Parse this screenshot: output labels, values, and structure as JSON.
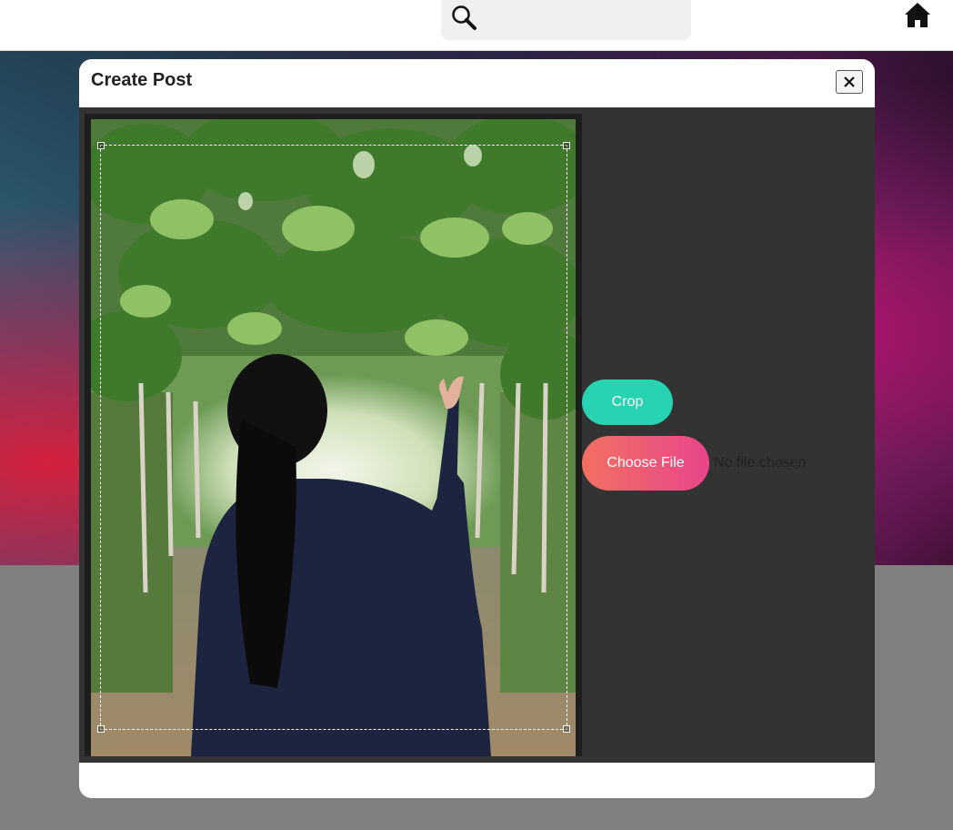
{
  "search": {
    "placeholder": "",
    "value": ""
  },
  "nav": {
    "home_icon": "home-icon"
  },
  "modal": {
    "title": "Create Post",
    "close_label": "✕",
    "crop_label": "Crop",
    "choose_file_label": "Choose File",
    "file_status": "No file chosen"
  },
  "colors": {
    "crop_button": "#27d3b0",
    "choose_file_start": "#f27062",
    "choose_file_end": "#e8458a",
    "modal_body": "#333333"
  },
  "icons": [
    "search-icon",
    "home-icon",
    "close-icon"
  ]
}
